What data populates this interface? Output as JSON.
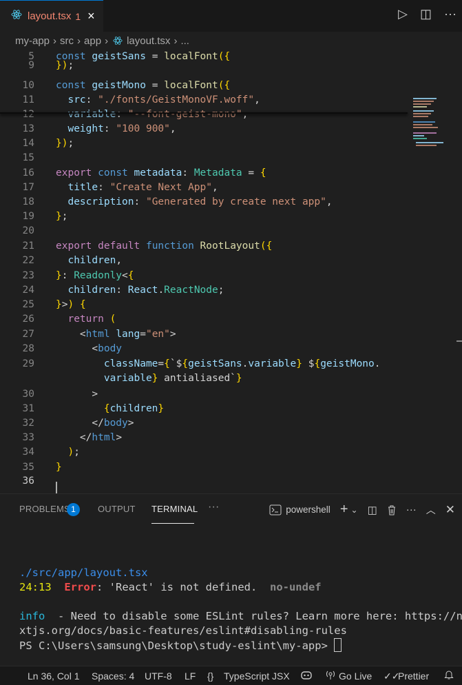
{
  "tab": {
    "label": "layout.tsx",
    "count": "1",
    "close_icon": "×"
  },
  "toolbar": {
    "run_icon": "▷",
    "split_icon": "◫",
    "more_icon": "···"
  },
  "breadcrumb": {
    "items": [
      "my-app",
      "src",
      "app",
      "layout.tsx",
      "..."
    ]
  },
  "editor": {
    "lines": [
      {
        "n": "5",
        "t": "const geistSans = localFont({"
      },
      {
        "n": "9",
        "t": "});"
      },
      {
        "n": "10",
        "t": "const geistMono = localFont({"
      },
      {
        "n": "11",
        "t": "  src: \"./fonts/GeistMonoVF.woff\","
      },
      {
        "n": "12",
        "t": "  variable: \"--font-geist-mono\","
      },
      {
        "n": "13",
        "t": "  weight: \"100 900\","
      },
      {
        "n": "14",
        "t": "});"
      },
      {
        "n": "15",
        "t": ""
      },
      {
        "n": "16",
        "t": "export const metadata: Metadata = {"
      },
      {
        "n": "17",
        "t": "  title: \"Create Next App\","
      },
      {
        "n": "18",
        "t": "  description: \"Generated by create next app\","
      },
      {
        "n": "19",
        "t": "};"
      },
      {
        "n": "20",
        "t": ""
      },
      {
        "n": "21",
        "t": "export default function RootLayout({"
      },
      {
        "n": "22",
        "t": "  children,"
      },
      {
        "n": "23",
        "t": "}: Readonly<{"
      },
      {
        "n": "24",
        "t": "  children: React.ReactNode;"
      },
      {
        "n": "25",
        "t": "}>) {"
      },
      {
        "n": "26",
        "t": "  return ("
      },
      {
        "n": "27",
        "t": "    <html lang=\"en\">"
      },
      {
        "n": "28",
        "t": "      <body"
      },
      {
        "n": "29",
        "t": "        className={`${geistSans.variable} ${geistMono."
      },
      {
        "n": "",
        "t": "        variable} antialiased`}"
      },
      {
        "n": "30",
        "t": "      >"
      },
      {
        "n": "31",
        "t": "        {children}"
      },
      {
        "n": "32",
        "t": "      </body>"
      },
      {
        "n": "33",
        "t": "    </html>"
      },
      {
        "n": "34",
        "t": "  );"
      },
      {
        "n": "35",
        "t": "}"
      },
      {
        "n": "36",
        "t": ""
      }
    ]
  },
  "panel": {
    "tabs": [
      "PROBLEMS",
      "OUTPUT",
      "TERMINAL"
    ],
    "problems_count": "1",
    "more": "···",
    "shell": "powershell"
  },
  "terminal": {
    "file": "./src/app/layout.tsx",
    "loc": "24:13",
    "err_label": "Error",
    "err_msg": ": 'React' is not defined.",
    "rule": "no-undef",
    "info_label": "info",
    "info_msg": "  - Need to disable some ESLint rules? Learn more here: https://ne",
    "info_msg2": "xtjs.org/docs/basic-features/eslint#disabling-rules",
    "prompt": "PS C:\\Users\\samsung\\Desktop\\study-eslint\\my-app> "
  },
  "status": {
    "position": "Ln 36, Col 1",
    "spaces": "Spaces: 4",
    "encoding": "UTF-8",
    "eol": "LF",
    "language": "TypeScript JSX",
    "golive": "Go Live",
    "prettier": "Prettier"
  }
}
